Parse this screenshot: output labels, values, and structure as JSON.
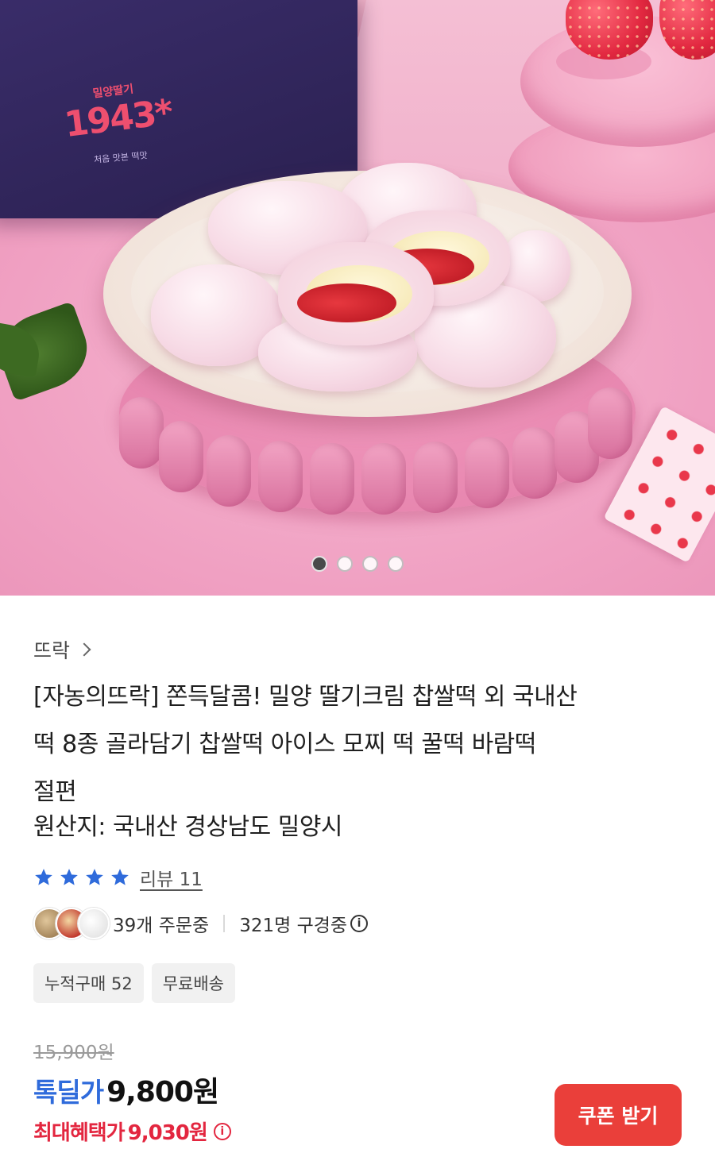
{
  "hero": {
    "box_logo": "1943*",
    "box_logo_small": "밀양딸기",
    "box_sub": "처음 맛본 떡맛",
    "carousel": {
      "total": 4,
      "active_index": 0
    }
  },
  "product": {
    "seller": "뜨락",
    "title_lines": [
      "[자농의뜨락] 쫀득달콤! 밀양 딸기크림 찹쌀떡 외 국내산",
      "떡 8종 골라담기 찹쌀떡 아이스 모찌 떡 꿀떡 바람떡",
      "절편"
    ],
    "origin": "원산지: 국내산 경상남도 밀양시",
    "rating": {
      "stars": 4,
      "review_label": "리뷰 11"
    },
    "orders_label": "39개 주문중",
    "viewers_label": "321명 구경중",
    "tags": [
      "누적구매 52",
      "무료배송"
    ],
    "original_price": "15,900원",
    "deal_label": "톡딜가",
    "deal_price": "9,800원",
    "max_benefit_label": "최대혜택가",
    "max_benefit_price": "9,030원",
    "coupon_button": "쿠폰 받기"
  },
  "colors": {
    "accent_blue": "#2f6bdb",
    "accent_red": "#e3263f",
    "coupon_bg": "#ea3f3a",
    "star": "#2f6bdb"
  },
  "icons": {
    "seller_chevron": "chevron-right-icon",
    "info": "info-icon",
    "star": "star-icon"
  }
}
